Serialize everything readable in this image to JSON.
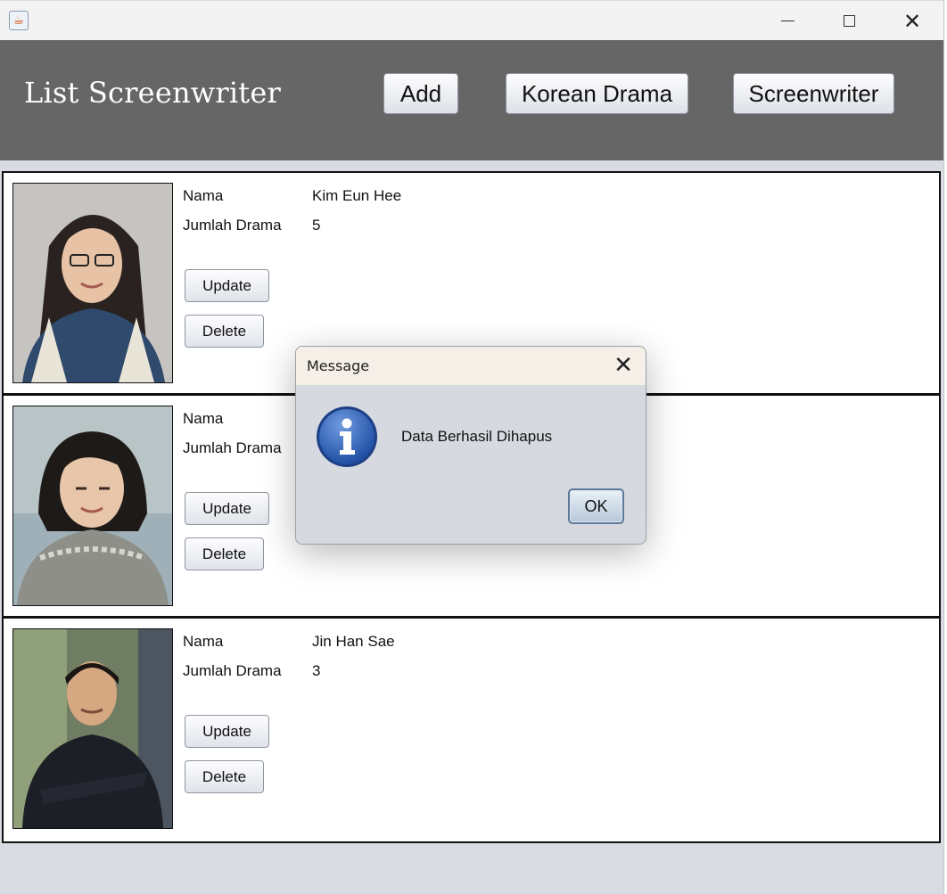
{
  "window": {
    "app_icon": "java-coffee-icon",
    "controls": {
      "minimize": "minimize-icon",
      "maximize": "maximize-icon",
      "close": "close-icon"
    }
  },
  "header": {
    "title": "List Screenwriter",
    "buttons": {
      "add": "Add",
      "korean_drama": "Korean Drama",
      "screenwriter": "Screenwriter"
    }
  },
  "screenwriters": [
    {
      "nama_label": "Nama",
      "nama_value": "Kim Eun Hee",
      "jumlah_label": "Jumlah Drama",
      "jumlah_value": "5",
      "update_label": "Update",
      "delete_label": "Delete"
    },
    {
      "nama_label": "Nama",
      "nama_value": "",
      "jumlah_label": "Jumlah Drama",
      "jumlah_value": "",
      "update_label": "Update",
      "delete_label": "Delete"
    },
    {
      "nama_label": "Nama",
      "nama_value": "Jin Han Sae",
      "jumlah_label": "Jumlah Drama",
      "jumlah_value": "3",
      "update_label": "Update",
      "delete_label": "Delete"
    }
  ],
  "dialog": {
    "title": "Message",
    "icon": "info-icon",
    "message": "Data Berhasil Dihapus",
    "ok_label": "OK"
  },
  "colors": {
    "header_bg": "#666666",
    "window_bg": "#d8dbe2",
    "dialog_titlebar": "#f6efe8",
    "info_blue": "#2f5fb3"
  }
}
